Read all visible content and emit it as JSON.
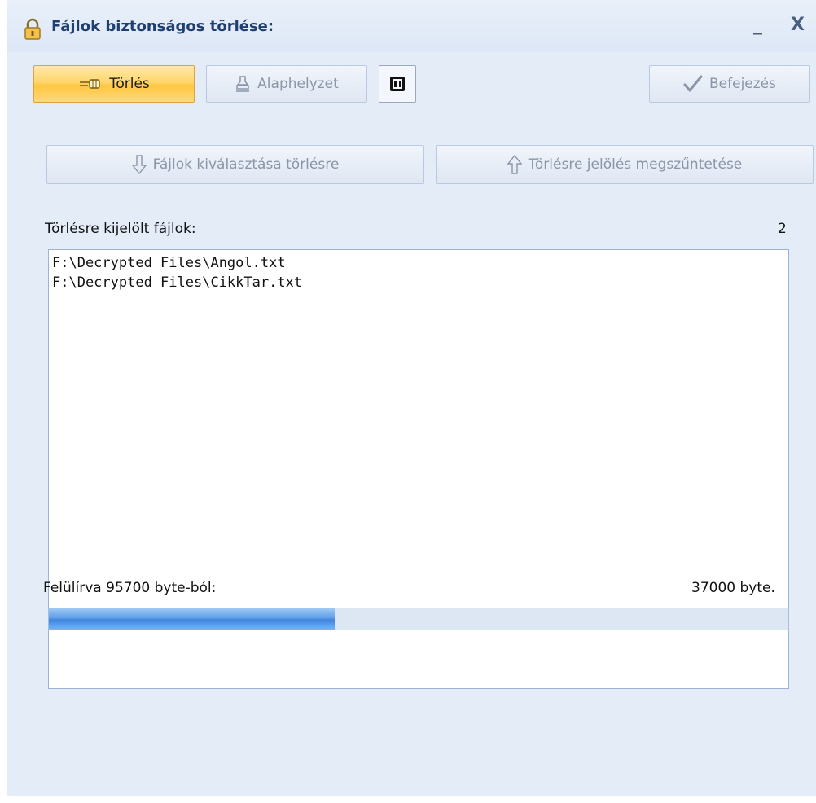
{
  "window": {
    "title": "Fájlok biztonságos törlése:",
    "minimize_glyph": "_",
    "close_glyph": "X"
  },
  "toolbar": {
    "delete_label": "Törlés",
    "reset_label": "Alaphelyzet",
    "finish_label": "Befejezés"
  },
  "actions": {
    "select_label": "Fájlok kiválasztása törlésre",
    "unmark_label": "Törlésre jelölés megszűntetése"
  },
  "files": {
    "heading": "Törlésre kijelölt fájlok:",
    "count": "2",
    "items": [
      "F:\\Decrypted Files\\Angol.txt",
      "F:\\Decrypted Files\\CikkTar.txt"
    ]
  },
  "progress": {
    "label": "Felülírva 95700 byte-ból:",
    "done_text": "37000 byte.",
    "fraction": 0.3866
  },
  "icons": {
    "title": "lock-icon",
    "delete": "pointing-hand-icon",
    "reset": "stamp-icon",
    "pause": "pause-icon",
    "finish": "checkmark-icon",
    "select": "arrow-down-icon",
    "unmark": "arrow-up-icon"
  },
  "colors": {
    "primary_button": "#ffd66e",
    "progress_fill": "#4a8fe4",
    "window_bg": "#e4ecf8"
  }
}
